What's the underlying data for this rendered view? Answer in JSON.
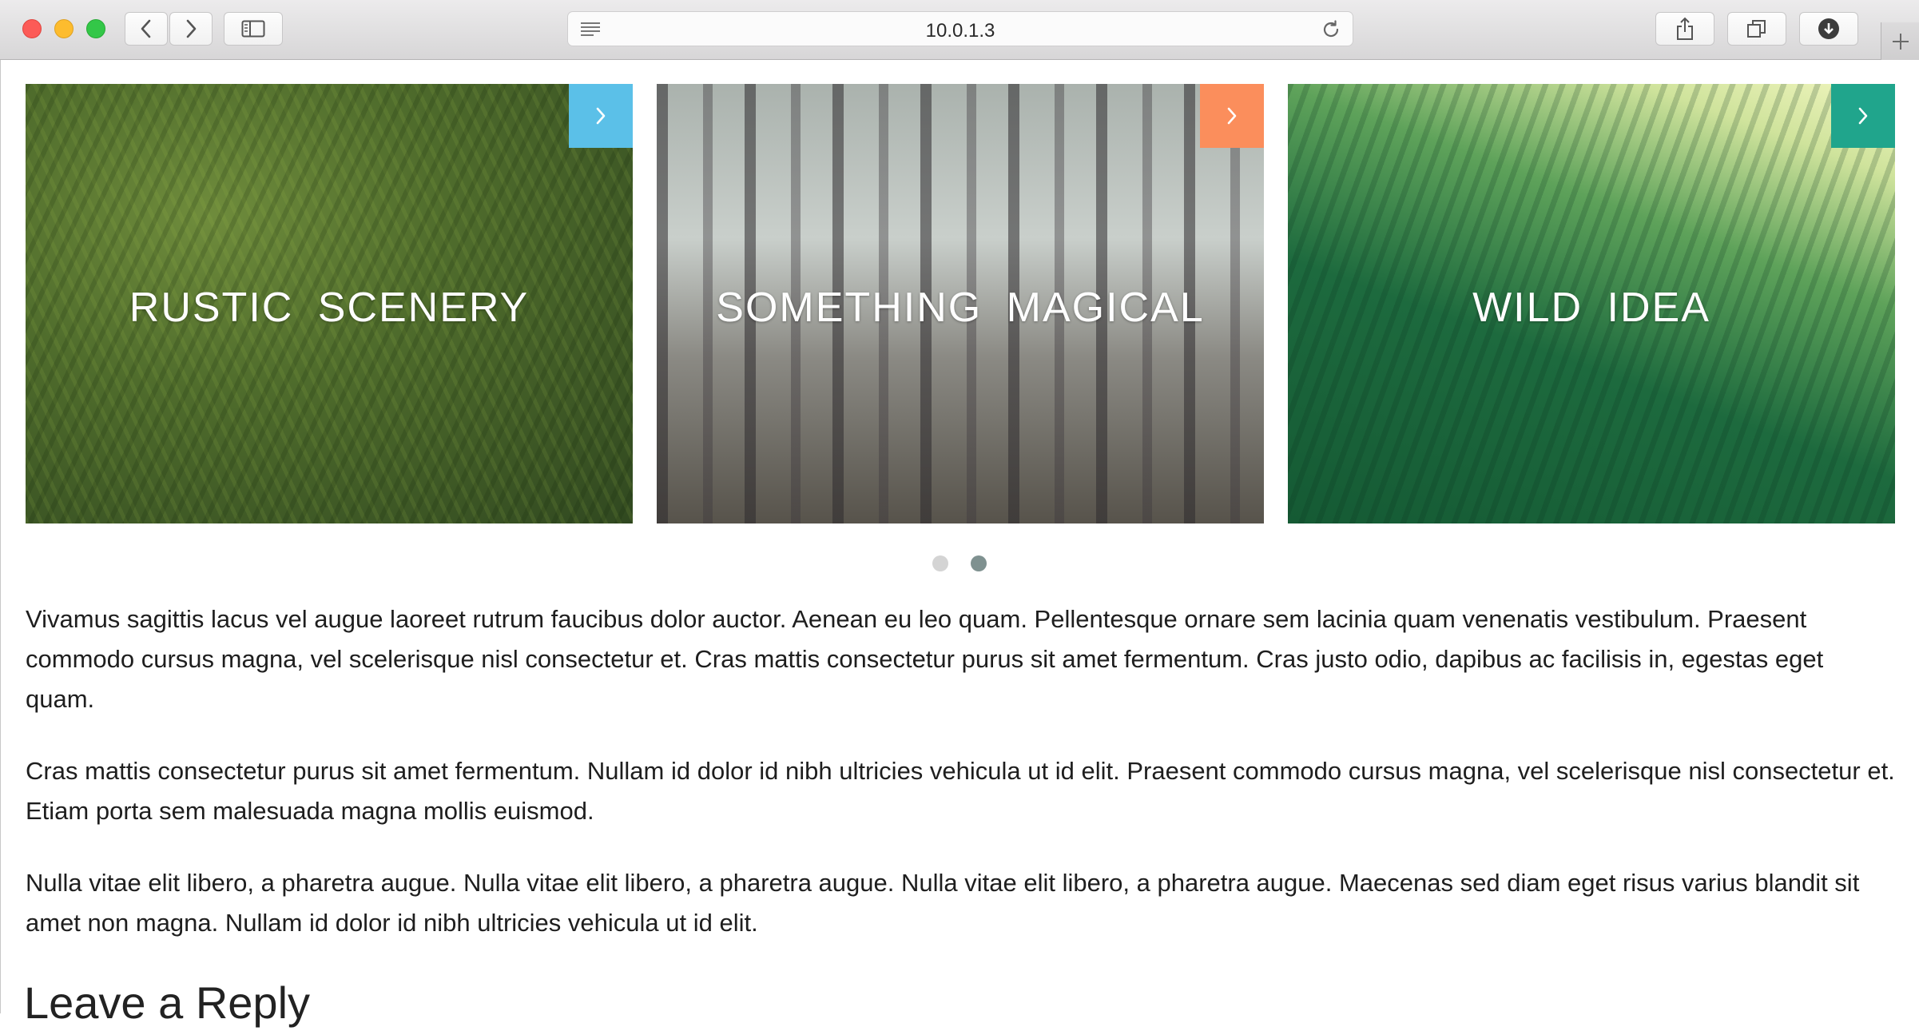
{
  "browser": {
    "url": "10.0.1.3",
    "icons": [
      "close-icon",
      "minimize-icon",
      "zoom-icon",
      "back-icon",
      "forward-icon",
      "sidebar-icon",
      "reader-icon",
      "reload-icon",
      "share-icon",
      "tabs-icon",
      "download-icon",
      "new-tab-icon"
    ]
  },
  "slider": {
    "slides": [
      {
        "title": "RUSTIC  SCENERY",
        "accent": "#5bc0e8"
      },
      {
        "title": "SOMETHING  MAGICAL",
        "accent": "#fb8e5c"
      },
      {
        "title": "WILD  IDEA",
        "accent": "#20a58c"
      }
    ],
    "dots": {
      "count": 2,
      "active_index": 1,
      "active_color": "#7f9190",
      "inactive_color": "#d4d4d4"
    }
  },
  "content": {
    "paragraphs": [
      "Vivamus sagittis lacus vel augue laoreet rutrum faucibus dolor auctor. Aenean eu leo quam. Pellentesque ornare sem lacinia quam venenatis vestibulum. Praesent commodo cursus magna, vel scelerisque nisl consectetur et. Cras mattis consectetur purus sit amet fermentum. Cras justo odio, dapibus ac facilisis in, egestas eget quam.",
      "Cras mattis consectetur purus sit amet fermentum. Nullam id dolor id nibh ultricies vehicula ut id elit. Praesent commodo cursus magna, vel scelerisque nisl consectetur et. Etiam porta sem malesuada magna mollis euismod.",
      "Nulla vitae elit libero, a pharetra augue. Nulla vitae elit libero, a pharetra augue. Nulla vitae elit libero, a pharetra augue. Maecenas sed diam eget risus varius blandit sit amet non magna. Nullam id dolor id nibh ultricies vehicula ut id elit."
    ],
    "reply_heading": "Leave a Reply"
  }
}
